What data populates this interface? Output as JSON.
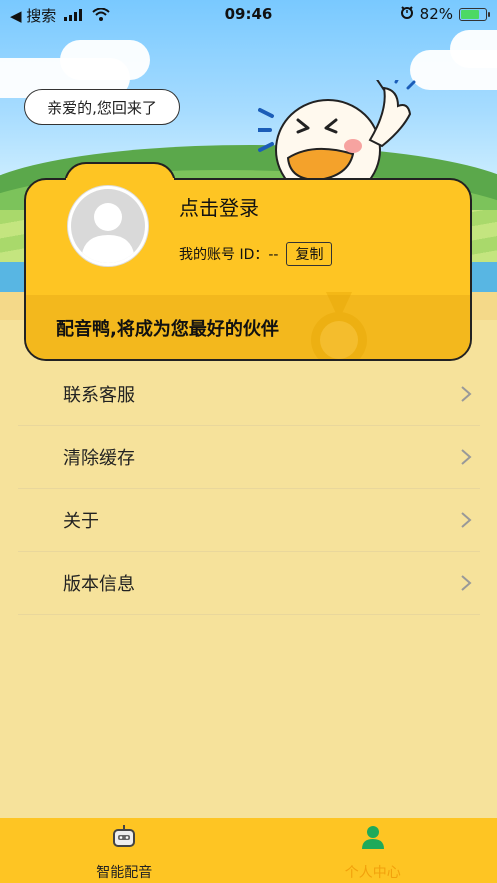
{
  "status_bar": {
    "back_label": "◀ 搜索",
    "time": "09:46",
    "battery_percent": "82%",
    "battery_level": 0.82
  },
  "header": {
    "greeting": "亲爱的,您回来了"
  },
  "profile_card": {
    "login_title": "点击登录",
    "account_label": "我的账号 ID：--",
    "copy_button": "复制",
    "slogan": "配音鸭,将成为您最好的伙伴"
  },
  "menu": {
    "items": [
      {
        "label": "联系客服"
      },
      {
        "label": "清除缓存"
      },
      {
        "label": "关于"
      },
      {
        "label": "版本信息"
      }
    ]
  },
  "tabbar": {
    "tabs": [
      {
        "label": "智能配音",
        "icon": "robot-icon",
        "active": false
      },
      {
        "label": "个人中心",
        "icon": "person-icon",
        "active": true
      }
    ],
    "active_color": "#1faa5a",
    "inactive_color": "#222222"
  },
  "colors": {
    "accent_yellow": "#fec523",
    "page_bg": "#f6e29b",
    "active_text": "#f2a10c"
  }
}
